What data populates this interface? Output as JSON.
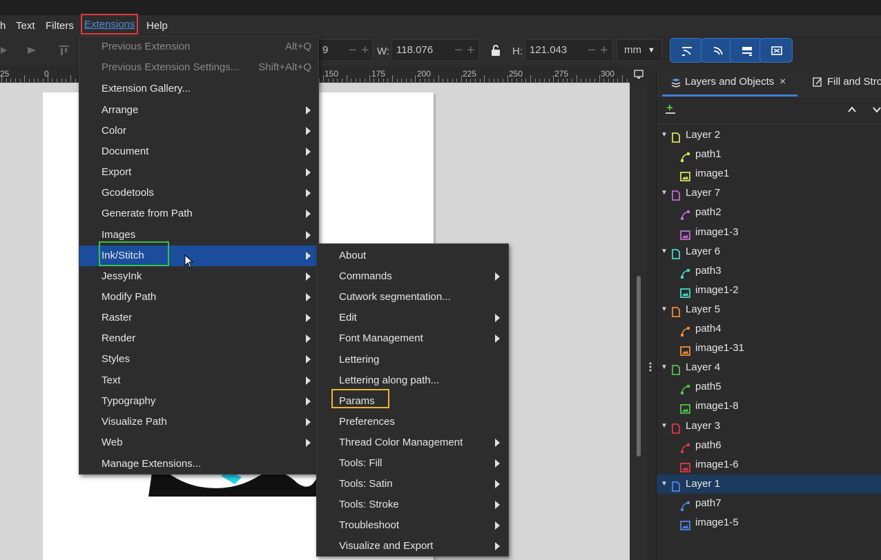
{
  "menubar": {
    "items": [
      "h",
      "Text",
      "Filters",
      "Extensions",
      "Help"
    ]
  },
  "toolbar": {
    "x_value": "9",
    "w_label": "W:",
    "w_value": "118.076",
    "h_label": "H:",
    "h_value": "121.043",
    "unit": "mm"
  },
  "ruler": {
    "ticks": [
      "25",
      "0",
      "150",
      "175",
      "200",
      "225",
      "250",
      "275",
      "300"
    ]
  },
  "extensions_menu": {
    "items": [
      {
        "label": "Previous Extension",
        "shortcut": "Alt+Q",
        "disabled": true
      },
      {
        "label": "Previous Extension Settings...",
        "shortcut": "Shift+Alt+Q",
        "disabled": true
      },
      {
        "label": "Extension Gallery...",
        "submenu": false
      },
      {
        "label": "Arrange",
        "submenu": true
      },
      {
        "label": "Color",
        "submenu": true
      },
      {
        "label": "Document",
        "submenu": true
      },
      {
        "label": "Export",
        "submenu": true
      },
      {
        "label": "Gcodetools",
        "submenu": true
      },
      {
        "label": "Generate from Path",
        "submenu": true
      },
      {
        "label": "Images",
        "submenu": true
      },
      {
        "label": "Ink/Stitch",
        "submenu": true,
        "highlighted": true
      },
      {
        "label": "JessyInk",
        "submenu": true
      },
      {
        "label": "Modify Path",
        "submenu": true
      },
      {
        "label": "Raster",
        "submenu": true
      },
      {
        "label": "Render",
        "submenu": true
      },
      {
        "label": "Styles",
        "submenu": true
      },
      {
        "label": "Text",
        "submenu": true
      },
      {
        "label": "Typography",
        "submenu": true
      },
      {
        "label": "Visualize Path",
        "submenu": true
      },
      {
        "label": "Web",
        "submenu": true
      },
      {
        "label": "Manage Extensions...",
        "submenu": false
      }
    ]
  },
  "inkstitch_menu": {
    "items": [
      {
        "label": "About",
        "submenu": false
      },
      {
        "label": "Commands",
        "submenu": true
      },
      {
        "label": "Cutwork segmentation...",
        "submenu": false
      },
      {
        "label": "Edit",
        "submenu": true
      },
      {
        "label": "Font Management",
        "submenu": true
      },
      {
        "label": "Lettering",
        "submenu": false
      },
      {
        "label": "Lettering along path...",
        "submenu": false
      },
      {
        "label": "Params",
        "submenu": false,
        "boxed": true
      },
      {
        "label": "Preferences",
        "submenu": false
      },
      {
        "label": "Thread Color Management",
        "submenu": true
      },
      {
        "label": "Tools: Fill",
        "submenu": true
      },
      {
        "label": "Tools: Satin",
        "submenu": true
      },
      {
        "label": "Tools: Stroke",
        "submenu": true
      },
      {
        "label": "Troubleshoot",
        "submenu": true
      },
      {
        "label": "Visualize and Export",
        "submenu": true
      }
    ]
  },
  "panel": {
    "tab_layers": "Layers and Objects",
    "tab_fill": "Fill and Stro",
    "tree": [
      {
        "type": "layer",
        "label": "Layer 2",
        "color": "#d8e05a"
      },
      {
        "type": "path",
        "label": "path1",
        "color": "#d8e05a"
      },
      {
        "type": "image",
        "label": "image1",
        "color": "#d8e05a"
      },
      {
        "type": "layer",
        "label": "Layer 7",
        "color": "#c46ad8"
      },
      {
        "type": "path",
        "label": "path2",
        "color": "#c46ad8"
      },
      {
        "type": "image",
        "label": "image1-3",
        "color": "#c46ad8"
      },
      {
        "type": "layer",
        "label": "Layer 6",
        "color": "#46d8c8"
      },
      {
        "type": "path",
        "label": "path3",
        "color": "#46d8c8"
      },
      {
        "type": "image",
        "label": "image1-2",
        "color": "#46d8c8"
      },
      {
        "type": "layer",
        "label": "Layer 5",
        "color": "#f08a3c"
      },
      {
        "type": "path",
        "label": "path4",
        "color": "#f08a3c"
      },
      {
        "type": "image",
        "label": "image1-31",
        "color": "#f08a3c"
      },
      {
        "type": "layer",
        "label": "Layer 4",
        "color": "#52c248"
      },
      {
        "type": "path",
        "label": "path5",
        "color": "#52c248"
      },
      {
        "type": "image",
        "label": "image1-8",
        "color": "#52c248"
      },
      {
        "type": "layer",
        "label": "Layer 3",
        "color": "#e0364a"
      },
      {
        "type": "path",
        "label": "path6",
        "color": "#e0364a"
      },
      {
        "type": "image",
        "label": "image1-6",
        "color": "#e0364a"
      },
      {
        "type": "layer",
        "label": "Layer 1",
        "color": "#4e86e6",
        "selected": true
      },
      {
        "type": "path",
        "label": "path7",
        "color": "#4e86e6"
      },
      {
        "type": "image",
        "label": "image1-5",
        "color": "#4e86e6"
      }
    ]
  }
}
